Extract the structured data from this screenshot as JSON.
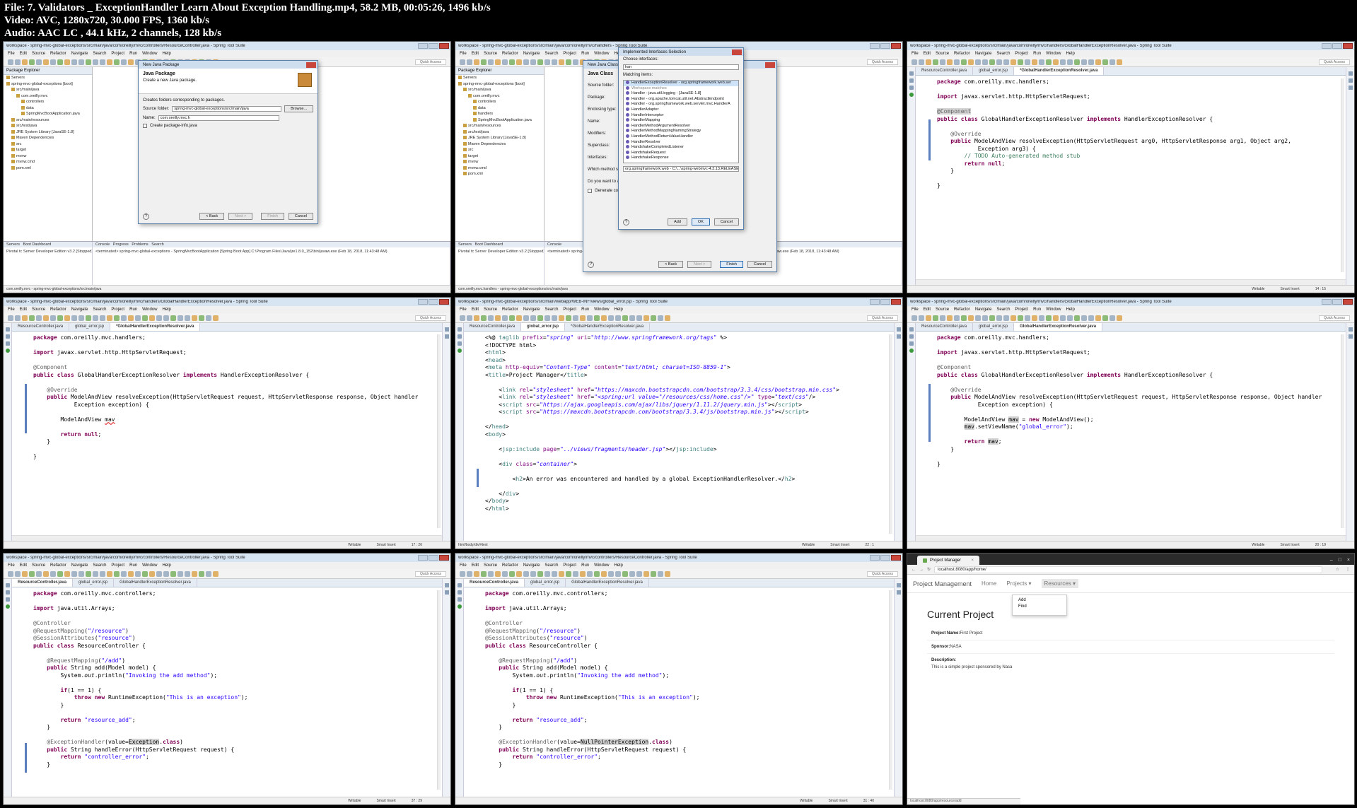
{
  "media_info": {
    "file_line": "File: 7. Validators _ ExceptionHandler Learn About Exception Handling.mp4, 58.2 MB, 00:05:26, 1496 kb/s",
    "video_line": "Video: AVC, 1280x720, 30.000 FPS, 1360 kb/s",
    "audio_line": "Audio: AAC LC , 44.1 kHz, 2 channels, 128 kb/s"
  },
  "ide_common": {
    "menu": [
      "File",
      "Edit",
      "Source",
      "Refactor",
      "Navigate",
      "Search",
      "Project",
      "Run",
      "Window",
      "Help"
    ],
    "quick_access": "Quick Access",
    "status_writable": "Writable",
    "status_insert": "Smart Insert"
  },
  "t1": {
    "title": "workspace - spring-mvc-global-exceptions/src/main/java/com/oreilly/mvc/controllers/ResourceController.java - Spring Tool Suite",
    "explorer_title": "Package Explorer",
    "tree": [
      "Servers",
      "spring-mvc-global-exceptions [boot]",
      "src/main/java",
      "com.oreilly.mvc",
      "controllers",
      "data",
      "SpringMvcBootApplication.java",
      "src/main/resources",
      "src/test/java",
      "JRE System Library [JavaSE-1.8]",
      "Maven Dependencies",
      "src",
      "target",
      "mvnw",
      "mvnw.cmd",
      "pom.xml"
    ],
    "dialog_title": "New Java Package",
    "dialog_heading": "Java Package",
    "dialog_sub": "Create a new Java package.",
    "dialog_desc": "Creates folders corresponding to packages.",
    "source_folder_label": "Source folder:",
    "source_folder_value": "spring-mvc-global-exceptions/src/main/java",
    "browse": "Browse...",
    "name_label": "Name:",
    "name_value": "com.oreilly.mvc.h",
    "create_info": "Create package-info.java",
    "back": "< Back",
    "next": "Next >",
    "finish": "Finish",
    "cancel": "Cancel",
    "code_fragment": "eption\");",
    "servers_panel": "Servers",
    "boot_dashboard": "Boot Dashboard",
    "server_item": "Pivotal tc Server Developer Edition v3.2  [Stopped]",
    "console_panel": "Console",
    "progress_tab": "Progress",
    "problems_tab": "Problems",
    "search_tab": "Search",
    "console_line": "<terminated> spring-mvc-global-exceptions - SpringMvcBootApplication [Spring Boot App] C:\\Program Files\\Java\\jre1.8.0_152\\bin\\javaw.exe (Feb 18, 2018, 11:43:48 AM)",
    "status_path": "com.oreilly.mvc - spring-mvc-global-exceptions/src/main/java"
  },
  "t2": {
    "title": "workspace - spring-mvc-global-exceptions/src/main/java/com/oreilly/mvc/handlers - Spring Tool Suite",
    "dialog_title": "Implemented Interfaces Selection",
    "choose_label": "Choose interfaces:",
    "filter_value": "han",
    "matching_label": "Matching items:",
    "items": [
      "HandlerExceptionResolver - org.springframework.web.ser",
      "Workspace matches",
      "Handler - java.util.logging - [JavaSE-1.8]",
      "Handler - org.apache.tomcat.util.net.AbstractEndpoint",
      "Handler - org.springframework.web.servlet.mvc.HandlerA",
      "HandlerAdapter",
      "HandlerInterceptor",
      "HandlerMapping",
      "HandlerMethodArgumentResolver",
      "HandlerMethodMappingNamingStrategy",
      "HandlerMethodReturnValueHandler",
      "HandlerResolver",
      "HandshakeCompletedListener",
      "HandshakeRequest",
      "HandshakeResponse"
    ],
    "jar_path": "org.springframework.web - C:\\...\\spring-webmvc-4.3.13.RELEASE.jar",
    "add": "Add",
    "ok": "OK",
    "cancel": "Cancel",
    "under_title": "New Java Class",
    "under_heading": "Java Class",
    "under_fields": [
      "Source folder:",
      "Package:",
      "Enclosing type:",
      "Name:",
      "Modifiers:",
      "Superclass:",
      "Interfaces:",
      "Which method stubs would you like to create?",
      "Do you want to add comments?"
    ],
    "generate_comments": "Generate comments",
    "back": "< Back",
    "next": "Next >",
    "finish": "Finish",
    "status_path": "com.oreilly.mvc.handlers - spring-mvc-global-exceptions/src/main/java",
    "explorer_tree": [
      "Servers",
      "spring-mvc-global-exceptions [boot]",
      "src/main/java",
      "com.oreilly.mvc",
      "controllers",
      "data",
      "handlers",
      "SpringMvcBootApplication.java",
      "src/main/resources",
      "src/test/java",
      "JRE System Library [JavaSE-1.8]",
      "Maven Dependencies",
      "src",
      "target",
      "mvnw",
      "mvnw.cmd",
      "pom.xml"
    ]
  },
  "t3": {
    "title": "workspace - spring-mvc-global-exceptions/src/main/java/com/oreilly/mvc/handlers/GlobalHandlerExceptionResolver.java - Spring Tool Suite",
    "tabs": [
      "ResourceController.java",
      "global_error.jsp",
      "*GlobalHandlerExceptionResolver.java"
    ],
    "position": "14 : 15"
  },
  "t4": {
    "title": "workspace - spring-mvc-global-exceptions/src/main/java/com/oreilly/mvc/handlers/GlobalHandlerExceptionResolver.java - Spring Tool Suite",
    "tabs": [
      "ResourceController.java",
      "global_error.jsp",
      "*GlobalHandlerExceptionResolver.java"
    ],
    "position": "17 : 26"
  },
  "t5": {
    "title": "workspace - spring-mvc-global-exceptions/src/main/webapp/WEB-INF/views/global_error.jsp - Spring Tool Suite",
    "tabs": [
      "ResourceController.java",
      "global_error.jsp",
      "*GlobalHandlerExceptionResolver.java"
    ],
    "position": "22 : 1",
    "status_path": "html/body/div/#text"
  },
  "t6": {
    "title": "workspace - spring-mvc-global-exceptions/src/main/java/com/oreilly/mvc/handlers/GlobalHandlerExceptionResolver.java - Spring Tool Suite",
    "tabs": [
      "ResourceController.java",
      "global_error.jsp",
      "GlobalHandlerExceptionResolver.java"
    ],
    "position": "20 : 19"
  },
  "t7": {
    "title": "workspace - spring-mvc-global-exceptions/src/main/java/com/oreilly/mvc/controllers/ResourceController.java - Spring Tool Suite",
    "tabs": [
      "ResourceController.java",
      "global_error.jsp",
      "GlobalHandlerExceptionResolver.java"
    ],
    "position": "37 : 29"
  },
  "t8": {
    "title": "workspace - spring-mvc-global-exceptions/src/main/java/com/oreilly/mvc/controllers/ResourceController.java - Spring Tool Suite",
    "tabs": [
      "ResourceController.java",
      "global_error.jsp",
      "GlobalHandlerExceptionResolver.java"
    ],
    "position": "31 : 40"
  },
  "t9": {
    "tab_title": "Project Manager",
    "url": "localhost:8080/app/home/",
    "brand": "Project Management",
    "nav": [
      "Home",
      "Projects ▾",
      "Resources ▾"
    ],
    "dropdown": [
      "Add",
      "Find"
    ],
    "heading": "Current Project",
    "fields": [
      {
        "label": "Project Name:",
        "value": "First Project"
      },
      {
        "label": "Sponsor:",
        "value": "NASA"
      },
      {
        "label": "Description:",
        "value": "This is a simple project sponsored by Nasa"
      }
    ],
    "status_url": "localhost:8080/app/resource/add"
  },
  "colors": {
    "keyword": "#7f0055",
    "annotation": "#646464",
    "string": "#2a00ff",
    "comment": "#3f7f5f",
    "title_bar": "#d7e4f2"
  }
}
